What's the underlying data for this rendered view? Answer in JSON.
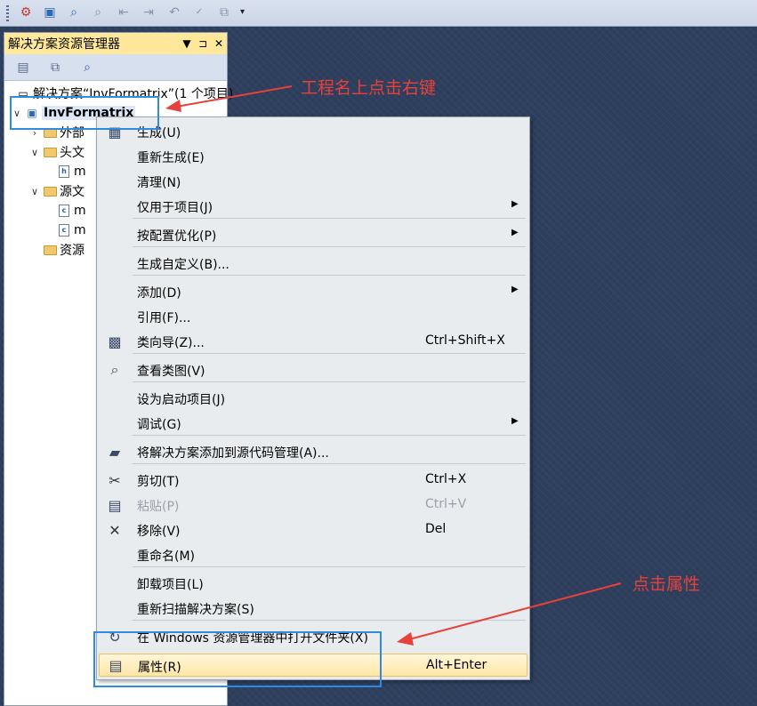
{
  "toolbar": {
    "icons": [
      "build-icon",
      "deploy-icon",
      "find-icon",
      "find-small-icon",
      "navigate-back-icon",
      "navigate-forward-icon",
      "undo-icon",
      "spell-check-icon",
      "copy-icon",
      "overflow-icon"
    ]
  },
  "explorer": {
    "title": "解决方案资源管理器",
    "title_controls": {
      "dropdown": "▼",
      "pin": "⊐",
      "close": "✕"
    },
    "tool_icons": [
      "properties-icon",
      "show-all-files-icon",
      "class-view-icon"
    ],
    "tree": [
      {
        "label": "解决方案“InvFormatrix”(1 个项目)",
        "type": "solution"
      },
      {
        "label": "InvFormatrix",
        "type": "project"
      },
      {
        "label": "外部",
        "type": "folder"
      },
      {
        "label": "头文",
        "type": "folder"
      },
      {
        "label": "m",
        "type": "header-file"
      },
      {
        "label": "源文",
        "type": "folder"
      },
      {
        "label": "m",
        "type": "source-file"
      },
      {
        "label": "m",
        "type": "source-file"
      },
      {
        "label": "资源",
        "type": "folder"
      }
    ]
  },
  "menu": {
    "items": [
      {
        "label": "生成(U)",
        "key": "",
        "icon": "build-icon",
        "submenu": false,
        "disabled": false
      },
      {
        "label": "重新生成(E)",
        "key": "",
        "icon": "",
        "submenu": false,
        "disabled": false
      },
      {
        "label": "清理(N)",
        "key": "",
        "icon": "",
        "submenu": false,
        "disabled": false
      },
      {
        "label": "仅用于项目(J)",
        "key": "",
        "icon": "",
        "submenu": true,
        "disabled": false
      },
      {
        "label": "按配置优化(P)",
        "key": "",
        "icon": "",
        "submenu": true,
        "disabled": false
      },
      {
        "label": "生成自定义(B)...",
        "key": "",
        "icon": "",
        "submenu": false,
        "disabled": false
      },
      {
        "label": "添加(D)",
        "key": "",
        "icon": "",
        "submenu": true,
        "disabled": false
      },
      {
        "label": "引用(F)...",
        "key": "",
        "icon": "",
        "submenu": false,
        "disabled": false
      },
      {
        "label": "类向导(Z)...",
        "key": "Ctrl+Shift+X",
        "icon": "class-wizard-icon",
        "submenu": false,
        "disabled": false
      },
      {
        "label": "查看类图(V)",
        "key": "",
        "icon": "class-diagram-icon",
        "submenu": false,
        "disabled": false
      },
      {
        "label": "设为启动项目(J)",
        "key": "",
        "icon": "",
        "submenu": false,
        "disabled": false
      },
      {
        "label": "调试(G)",
        "key": "",
        "icon": "",
        "submenu": true,
        "disabled": false
      },
      {
        "label": "将解决方案添加到源代码管理(A)...",
        "key": "",
        "icon": "add-to-source-control-icon",
        "submenu": false,
        "disabled": false
      },
      {
        "label": "剪切(T)",
        "key": "Ctrl+X",
        "icon": "scissors-icon",
        "submenu": false,
        "disabled": false
      },
      {
        "label": "粘贴(P)",
        "key": "Ctrl+V",
        "icon": "paste-icon",
        "submenu": false,
        "disabled": true
      },
      {
        "label": "移除(V)",
        "key": "Del",
        "icon": "remove-icon",
        "submenu": false,
        "disabled": false
      },
      {
        "label": "重命名(M)",
        "key": "",
        "icon": "",
        "submenu": false,
        "disabled": false
      },
      {
        "label": "卸载项目(L)",
        "key": "",
        "icon": "",
        "submenu": false,
        "disabled": false
      },
      {
        "label": "重新扫描解决方案(S)",
        "key": "",
        "icon": "",
        "submenu": false,
        "disabled": false
      },
      {
        "label": "在 Windows 资源管理器中打开文件夹(X)",
        "key": "",
        "icon": "open-folder-icon",
        "submenu": false,
        "disabled": false
      },
      {
        "label": "属性(R)",
        "key": "Alt+Enter",
        "icon": "properties-icon",
        "submenu": false,
        "disabled": false,
        "highlighted": true
      }
    ]
  },
  "annotations": {
    "right_click_note": "工程名上点击右键",
    "properties_note": "点击属性",
    "color": "#e8403a",
    "box_color": "#2f8be0"
  }
}
